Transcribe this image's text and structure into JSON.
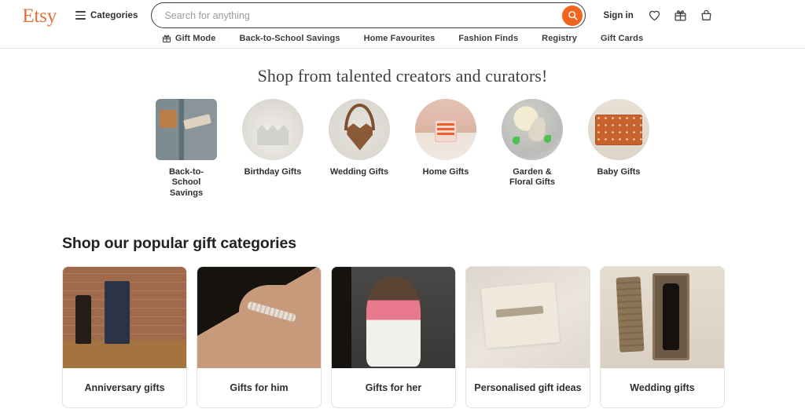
{
  "header": {
    "logo_text": "Etsy",
    "categories_label": "Categories",
    "search": {
      "placeholder": "Search for anything",
      "value": "",
      "button_icon": "search-icon"
    },
    "sign_in_label": "Sign in",
    "icons": [
      {
        "name": "favorites-heart-icon"
      },
      {
        "name": "gift-icon"
      },
      {
        "name": "cart-bag-icon"
      }
    ],
    "nav_items": [
      {
        "label": "Gift Mode",
        "icon": "gift-icon"
      },
      {
        "label": "Back-to-School Savings",
        "icon": ""
      },
      {
        "label": "Home Favourites",
        "icon": ""
      },
      {
        "label": "Fashion Finds",
        "icon": ""
      },
      {
        "label": "Registry",
        "icon": ""
      },
      {
        "label": "Gift Cards",
        "icon": ""
      }
    ]
  },
  "hero": {
    "title": "Shop from talented creators and curators!"
  },
  "circle_categories": [
    {
      "label": "Back-to-School Savings",
      "art": "art-locker",
      "selected": true
    },
    {
      "label": "Birthday Gifts",
      "art": "art-crown",
      "selected": false
    },
    {
      "label": "Wedding Gifts",
      "art": "art-wedding",
      "selected": false
    },
    {
      "label": "Home Gifts",
      "art": "art-candle",
      "selected": false
    },
    {
      "label": "Garden & Floral Gifts",
      "art": "art-garden",
      "selected": false
    },
    {
      "label": "Baby Gifts",
      "art": "art-baby",
      "selected": false
    }
  ],
  "popular_section": {
    "title": "Shop our popular gift categories",
    "cards": [
      {
        "label": "Anniversary gifts",
        "art": "c-anniv"
      },
      {
        "label": "Gifts for him",
        "art": "c-him"
      },
      {
        "label": "Gifts for her",
        "art": "c-her"
      },
      {
        "label": "Personalised gift ideas",
        "art": "c-personal"
      },
      {
        "label": "Wedding gifts",
        "art": "c-wedding"
      }
    ]
  },
  "colors": {
    "brand_orange": "#e2703a",
    "search_button_orange": "#f1641e",
    "text_dark": "#2f2f2f",
    "border_gray": "#e1e3df"
  }
}
